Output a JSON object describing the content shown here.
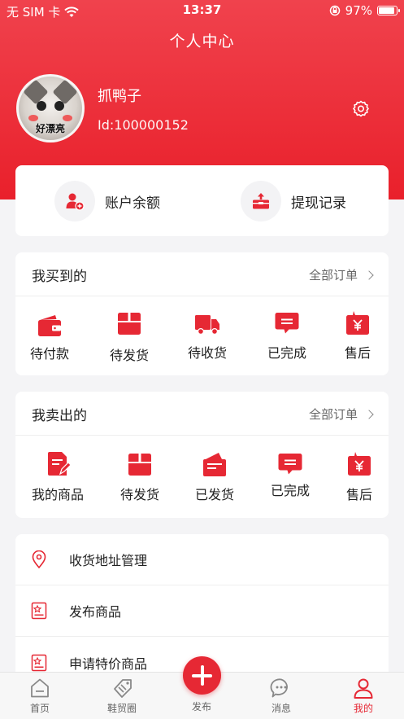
{
  "status_bar": {
    "carrier": "无 SIM 卡",
    "time": "13:37",
    "battery": "97%",
    "battery_level": 0.97
  },
  "header": {
    "title": "个人中心"
  },
  "profile": {
    "nickname": "抓鸭子",
    "user_id": "Id:100000152",
    "avatar_caption": "好漂亮"
  },
  "wallet": {
    "balance_label": "账户余额",
    "withdraw_label": "提现记录"
  },
  "bought": {
    "title": "我买到的",
    "all_orders": "全部订单",
    "items": [
      {
        "label": "待付款",
        "icon": "wallet-icon"
      },
      {
        "label": "待发货",
        "icon": "package-icon"
      },
      {
        "label": "待收货",
        "icon": "truck-icon"
      },
      {
        "label": "已完成",
        "icon": "message-icon"
      },
      {
        "label": "售后",
        "icon": "yen-box-icon"
      }
    ]
  },
  "sold": {
    "title": "我卖出的",
    "all_orders": "全部订单",
    "items": [
      {
        "label": "我的商品",
        "icon": "document-edit-icon"
      },
      {
        "label": "待发货",
        "icon": "package-icon"
      },
      {
        "label": "已发货",
        "icon": "envelope-icon"
      },
      {
        "label": "已完成",
        "icon": "message-icon"
      },
      {
        "label": "售后",
        "icon": "yen-box-icon"
      }
    ]
  },
  "menu": [
    {
      "label": "收货地址管理",
      "icon": "location-pin-icon"
    },
    {
      "label": "发布商品",
      "icon": "star-card-icon"
    },
    {
      "label": "申请特价商品",
      "icon": "star-card-icon"
    }
  ],
  "tabbar": {
    "items": [
      {
        "label": "首页",
        "icon": "home-icon"
      },
      {
        "label": "鞋贸圈",
        "icon": "shoe-tag-icon"
      },
      {
        "label": "发布",
        "icon": "plus-icon"
      },
      {
        "label": "消息",
        "icon": "chat-icon"
      },
      {
        "label": "我的",
        "icon": "user-icon"
      }
    ],
    "active": "我的"
  },
  "colors": {
    "brand_red": "#e62834",
    "header_top": "#f0424d",
    "header_bottom": "#e9202b"
  }
}
